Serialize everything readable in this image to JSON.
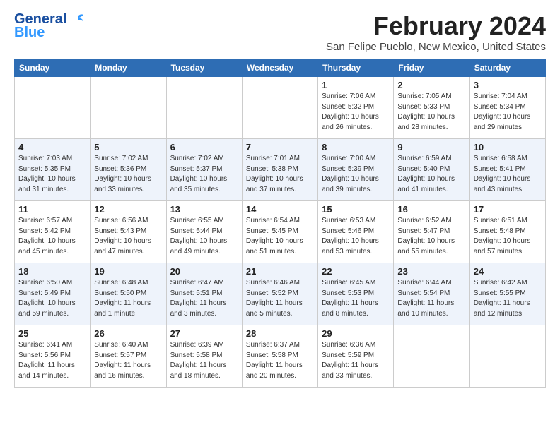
{
  "logo": {
    "line1": "General",
    "line2": "Blue"
  },
  "header": {
    "month_year": "February 2024",
    "location": "San Felipe Pueblo, New Mexico, United States"
  },
  "weekdays": [
    "Sunday",
    "Monday",
    "Tuesday",
    "Wednesday",
    "Thursday",
    "Friday",
    "Saturday"
  ],
  "weeks": [
    [
      {
        "day": "",
        "info": ""
      },
      {
        "day": "",
        "info": ""
      },
      {
        "day": "",
        "info": ""
      },
      {
        "day": "",
        "info": ""
      },
      {
        "day": "1",
        "info": "Sunrise: 7:06 AM\nSunset: 5:32 PM\nDaylight: 10 hours\nand 26 minutes."
      },
      {
        "day": "2",
        "info": "Sunrise: 7:05 AM\nSunset: 5:33 PM\nDaylight: 10 hours\nand 28 minutes."
      },
      {
        "day": "3",
        "info": "Sunrise: 7:04 AM\nSunset: 5:34 PM\nDaylight: 10 hours\nand 29 minutes."
      }
    ],
    [
      {
        "day": "4",
        "info": "Sunrise: 7:03 AM\nSunset: 5:35 PM\nDaylight: 10 hours\nand 31 minutes."
      },
      {
        "day": "5",
        "info": "Sunrise: 7:02 AM\nSunset: 5:36 PM\nDaylight: 10 hours\nand 33 minutes."
      },
      {
        "day": "6",
        "info": "Sunrise: 7:02 AM\nSunset: 5:37 PM\nDaylight: 10 hours\nand 35 minutes."
      },
      {
        "day": "7",
        "info": "Sunrise: 7:01 AM\nSunset: 5:38 PM\nDaylight: 10 hours\nand 37 minutes."
      },
      {
        "day": "8",
        "info": "Sunrise: 7:00 AM\nSunset: 5:39 PM\nDaylight: 10 hours\nand 39 minutes."
      },
      {
        "day": "9",
        "info": "Sunrise: 6:59 AM\nSunset: 5:40 PM\nDaylight: 10 hours\nand 41 minutes."
      },
      {
        "day": "10",
        "info": "Sunrise: 6:58 AM\nSunset: 5:41 PM\nDaylight: 10 hours\nand 43 minutes."
      }
    ],
    [
      {
        "day": "11",
        "info": "Sunrise: 6:57 AM\nSunset: 5:42 PM\nDaylight: 10 hours\nand 45 minutes."
      },
      {
        "day": "12",
        "info": "Sunrise: 6:56 AM\nSunset: 5:43 PM\nDaylight: 10 hours\nand 47 minutes."
      },
      {
        "day": "13",
        "info": "Sunrise: 6:55 AM\nSunset: 5:44 PM\nDaylight: 10 hours\nand 49 minutes."
      },
      {
        "day": "14",
        "info": "Sunrise: 6:54 AM\nSunset: 5:45 PM\nDaylight: 10 hours\nand 51 minutes."
      },
      {
        "day": "15",
        "info": "Sunrise: 6:53 AM\nSunset: 5:46 PM\nDaylight: 10 hours\nand 53 minutes."
      },
      {
        "day": "16",
        "info": "Sunrise: 6:52 AM\nSunset: 5:47 PM\nDaylight: 10 hours\nand 55 minutes."
      },
      {
        "day": "17",
        "info": "Sunrise: 6:51 AM\nSunset: 5:48 PM\nDaylight: 10 hours\nand 57 minutes."
      }
    ],
    [
      {
        "day": "18",
        "info": "Sunrise: 6:50 AM\nSunset: 5:49 PM\nDaylight: 10 hours\nand 59 minutes."
      },
      {
        "day": "19",
        "info": "Sunrise: 6:48 AM\nSunset: 5:50 PM\nDaylight: 11 hours\nand 1 minute."
      },
      {
        "day": "20",
        "info": "Sunrise: 6:47 AM\nSunset: 5:51 PM\nDaylight: 11 hours\nand 3 minutes."
      },
      {
        "day": "21",
        "info": "Sunrise: 6:46 AM\nSunset: 5:52 PM\nDaylight: 11 hours\nand 5 minutes."
      },
      {
        "day": "22",
        "info": "Sunrise: 6:45 AM\nSunset: 5:53 PM\nDaylight: 11 hours\nand 8 minutes."
      },
      {
        "day": "23",
        "info": "Sunrise: 6:44 AM\nSunset: 5:54 PM\nDaylight: 11 hours\nand 10 minutes."
      },
      {
        "day": "24",
        "info": "Sunrise: 6:42 AM\nSunset: 5:55 PM\nDaylight: 11 hours\nand 12 minutes."
      }
    ],
    [
      {
        "day": "25",
        "info": "Sunrise: 6:41 AM\nSunset: 5:56 PM\nDaylight: 11 hours\nand 14 minutes."
      },
      {
        "day": "26",
        "info": "Sunrise: 6:40 AM\nSunset: 5:57 PM\nDaylight: 11 hours\nand 16 minutes."
      },
      {
        "day": "27",
        "info": "Sunrise: 6:39 AM\nSunset: 5:58 PM\nDaylight: 11 hours\nand 18 minutes."
      },
      {
        "day": "28",
        "info": "Sunrise: 6:37 AM\nSunset: 5:58 PM\nDaylight: 11 hours\nand 20 minutes."
      },
      {
        "day": "29",
        "info": "Sunrise: 6:36 AM\nSunset: 5:59 PM\nDaylight: 11 hours\nand 23 minutes."
      },
      {
        "day": "",
        "info": ""
      },
      {
        "day": "",
        "info": ""
      }
    ]
  ]
}
